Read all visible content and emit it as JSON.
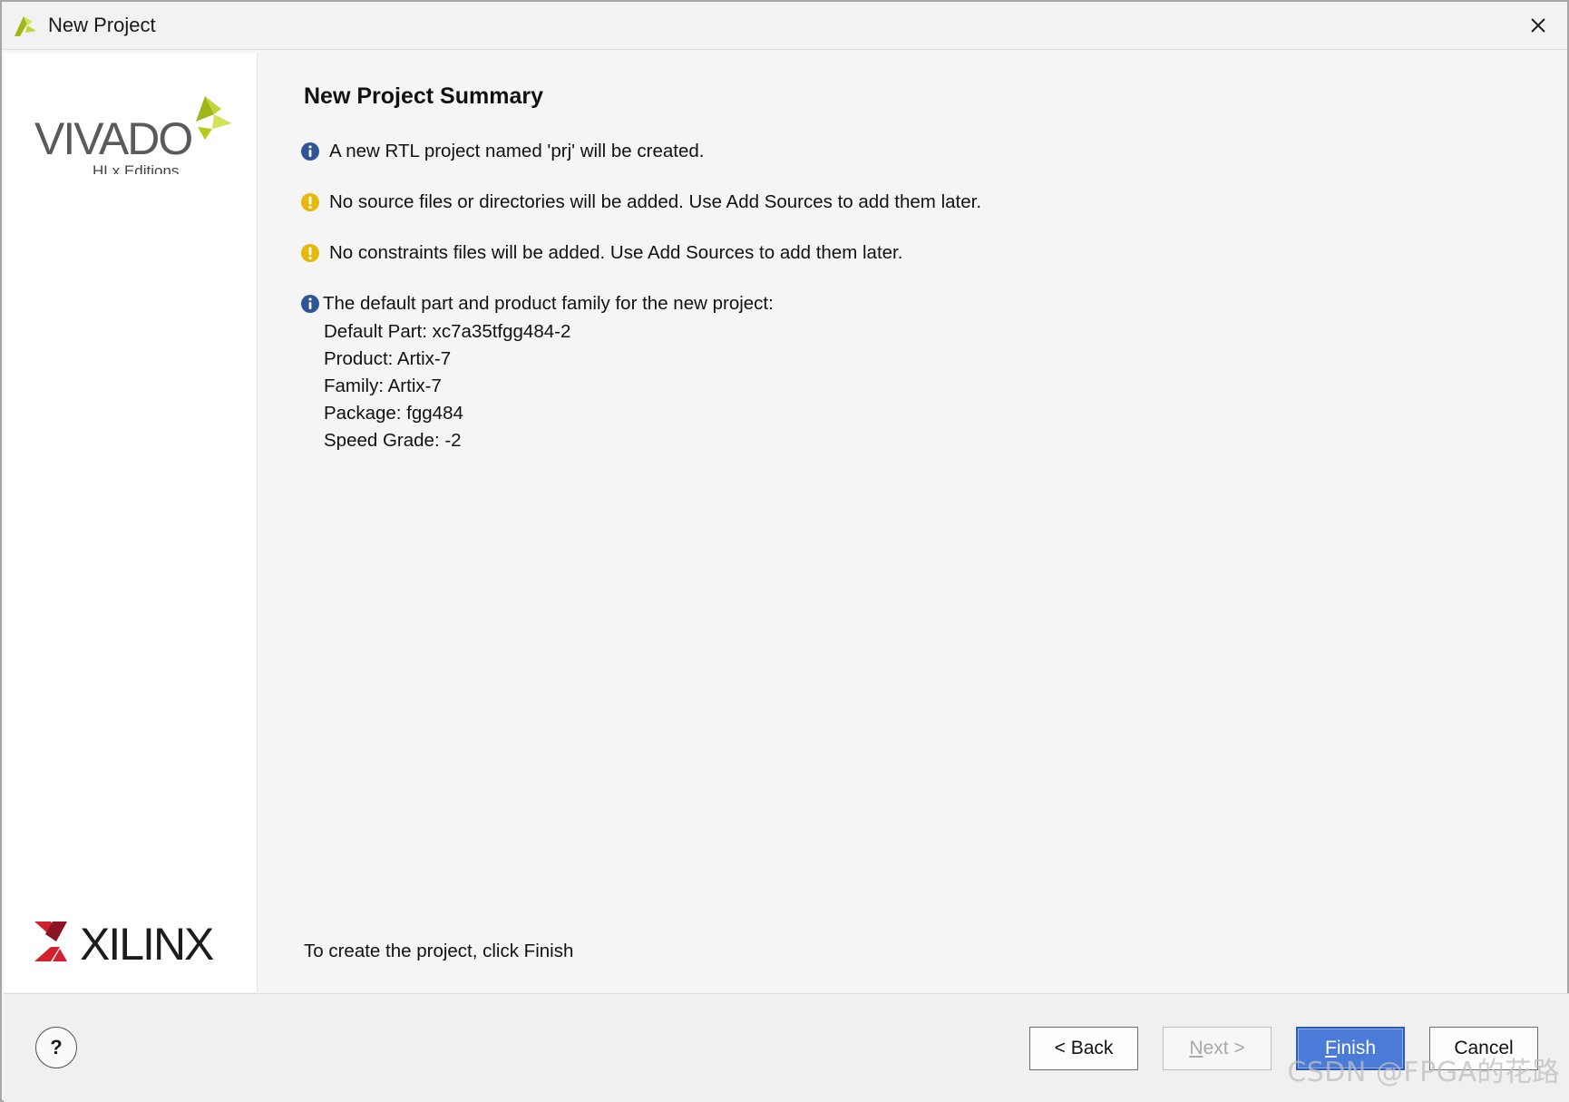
{
  "window": {
    "title": "New Project",
    "close_label": "Close"
  },
  "brand": {
    "vivado_text": "VIVADO",
    "vivado_sub": "HLx Editions",
    "xilinx_text": "XILINX"
  },
  "summary": {
    "title": "New Project Summary",
    "messages": [
      {
        "icon": "info-icon",
        "text": "A new RTL project named 'prj' will be created."
      },
      {
        "icon": "warning-icon",
        "text": "No source files or directories will be added. Use Add Sources to add them later."
      },
      {
        "icon": "warning-icon",
        "text": "No constraints files will be added. Use Add Sources to add them later."
      },
      {
        "icon": "info-icon",
        "text": "The default part and product family for the new project:"
      }
    ],
    "details": [
      "Default Part: xc7a35tfgg484-2",
      "Product: Artix-7",
      "Family: Artix-7",
      "Package: fgg484",
      "Speed Grade: -2"
    ],
    "footer": "To create the project, click Finish"
  },
  "buttons": {
    "help": "?",
    "back": "< Back",
    "next_mnemonic": "N",
    "next_rest": "ext >",
    "finish_mnemonic": "F",
    "finish_rest": "inish",
    "cancel": "Cancel"
  },
  "watermark": "CSDN @FPGA的花路",
  "colors": {
    "info": "#2f5597",
    "warning": "#e5b80b",
    "primary_button": "#4a7bd8",
    "xilinx_red": "#d2202f",
    "vivado_green": "#b6c91c"
  }
}
